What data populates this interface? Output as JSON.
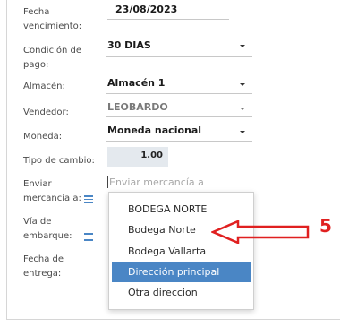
{
  "fields": {
    "fecha_vencimiento": {
      "label_1": "Fecha",
      "label_2": "vencimiento:",
      "value": "23/08/2023"
    },
    "condicion_pago": {
      "label_1": "Condición de",
      "label_2": "pago:",
      "value": "30 DIAS"
    },
    "almacen": {
      "label": "Almacén:",
      "value": "Almacén 1"
    },
    "vendedor": {
      "label": "Vendedor:",
      "value": "LEOBARDO"
    },
    "moneda": {
      "label": "Moneda:",
      "value": "Moneda nacional"
    },
    "tipo_cambio": {
      "label": "Tipo de cambio:",
      "value": "1.00"
    },
    "enviar_mercancia": {
      "label_1": "Enviar",
      "label_2": "mercancía a:",
      "placeholder": "Enviar mercancía a"
    },
    "via_embarque": {
      "label_1": "Vía de",
      "label_2": "embarque:"
    },
    "fecha_entrega": {
      "label_1": "Fecha de",
      "label_2": "entrega:"
    }
  },
  "dropdown": {
    "options": [
      "BODEGA NORTE",
      "Bodega Norte",
      "Bodega Vallarta",
      "Dirección principal",
      "Otra direccion"
    ],
    "selected": "Dirección principal"
  },
  "annotation": {
    "number": "5",
    "color": "#e02020"
  },
  "colors": {
    "accent": "#4a86c5",
    "annotation": "#e02020"
  }
}
